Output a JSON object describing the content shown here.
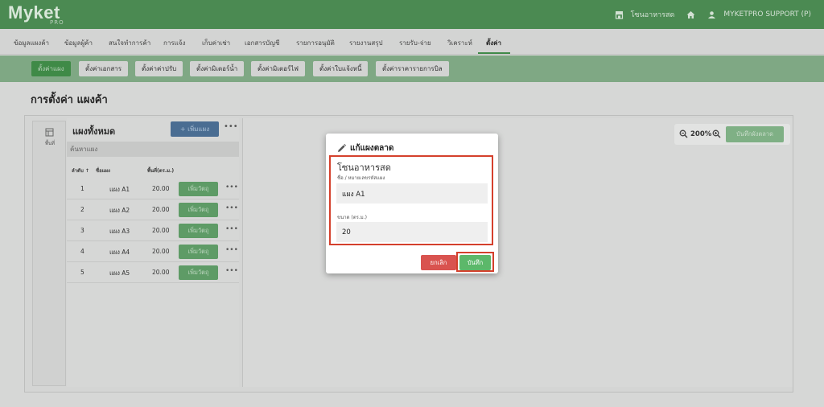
{
  "app": {
    "logo": "Myket",
    "logo_sub": "PRO"
  },
  "topbar": {
    "zone": "โซนอาหารสด",
    "user": "MYKETPRO SUPPORT (P)"
  },
  "nav": {
    "items": [
      "ข้อมูลแผงค้า",
      "ข้อมูลผู้ค้า",
      "สนใจทำการค้า",
      "การแจ้ง",
      "เก็บค่าเช่า",
      "เอกสารบัญชี",
      "รายการอนุมัติ",
      "รายงานสรุป",
      "รายรับ-จ่าย",
      "วิเคราะห์",
      "ตั้งค่า"
    ],
    "active": "ตั้งค่า"
  },
  "subnav": {
    "items": [
      "ตั้งค่าแผง",
      "ตั้งค่าเอกสาร",
      "ตั้งค่าค่าปรับ",
      "ตั้งค่ามิเตอร์น้ำ",
      "ตั้งค่ามิเตอร์ไฟ",
      "ตั้งค่าใบแจ้งหนี้",
      "ตั้งค่าราคารายการบิล"
    ],
    "active": "ตั้งค่าแผง"
  },
  "page": {
    "title": "การตั้งค่า แผงค้า",
    "side_tab": "พื้นที่"
  },
  "stall_panel": {
    "title": "แผงทั้งหมด",
    "add_button": "+ เพิ่มแผง",
    "search_placeholder": "ค้นหาแผง",
    "columns": [
      "ลำดับ ↑",
      "ชื่อแผง",
      "พื้นที่(ตร.ม.)"
    ],
    "rows": [
      {
        "no": "1",
        "name": "แผง A1",
        "area": "20.00",
        "action": "เพิ่มวัตถุ"
      },
      {
        "no": "2",
        "name": "แผง A2",
        "area": "20.00",
        "action": "เพิ่มวัตถุ"
      },
      {
        "no": "3",
        "name": "แผง A3",
        "area": "20.00",
        "action": "เพิ่มวัตถุ"
      },
      {
        "no": "4",
        "name": "แผง A4",
        "area": "20.00",
        "action": "เพิ่มวัตถุ"
      },
      {
        "no": "5",
        "name": "แผง A5",
        "area": "20.00",
        "action": "เพิ่มวัตถุ"
      }
    ]
  },
  "canvas": {
    "zoom": "200%",
    "save_layout": "บันทึกผังตลาด"
  },
  "modal": {
    "title": "แก้แผงตลาด",
    "zone_name": "โซนอาหารสด",
    "name_label": "ชื่อ / หมายเลขรหัสแผง",
    "name_value": "แผง A1",
    "size_label": "ขนาด (ตร.ม.)",
    "size_value": "20",
    "cancel": "ยกเลิก",
    "save": "บันทึก"
  },
  "colors": {
    "brand_green": "#4b8a52",
    "highlight_red": "#d4402c",
    "save_green": "#5cb86a",
    "cancel_red": "#d9534f"
  }
}
